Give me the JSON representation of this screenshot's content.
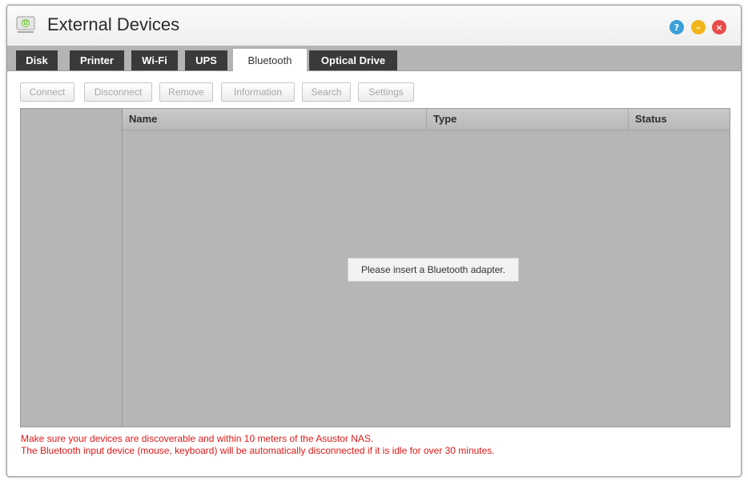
{
  "window": {
    "title": "External Devices",
    "controls": {
      "help": "?",
      "minimize": "–",
      "close": "×"
    }
  },
  "tabs": [
    {
      "label": "Disk",
      "active": false
    },
    {
      "label": "Printer",
      "active": false
    },
    {
      "label": "Wi-Fi",
      "active": false
    },
    {
      "label": "UPS",
      "active": false
    },
    {
      "label": "Bluetooth",
      "active": true
    },
    {
      "label": "Optical Drive",
      "active": false
    }
  ],
  "toolbar": {
    "buttons": [
      {
        "label": "Connect",
        "enabled": false
      },
      {
        "label": "Disconnect",
        "enabled": false
      },
      {
        "label": "Remove",
        "enabled": false
      },
      {
        "label": "Information",
        "enabled": false
      },
      {
        "label": "Search",
        "enabled": false
      },
      {
        "label": "Settings",
        "enabled": false
      }
    ]
  },
  "table": {
    "columns": [
      "Name",
      "Type",
      "Status"
    ],
    "rows": [],
    "empty_message": "Please insert a Bluetooth adapter."
  },
  "notes": [
    "Make sure your devices are discoverable and within 10 meters of the Asustor NAS.",
    "The Bluetooth input device (mouse, keyboard) will be automatically disconnected if it is idle for over 30 minutes."
  ],
  "colors": {
    "tab_bg": "#3a3a3a",
    "tab_active_bg": "#ffffff",
    "panel_bg": "#b6b6b6",
    "note_text": "#e01818",
    "help_button": "#3aa0d8",
    "minimize_button": "#f0b51a",
    "close_button": "#e84a4a"
  },
  "icons": {
    "app": "external-devices-icon",
    "help": "help-icon",
    "minimize": "minimize-icon",
    "close": "close-icon"
  }
}
